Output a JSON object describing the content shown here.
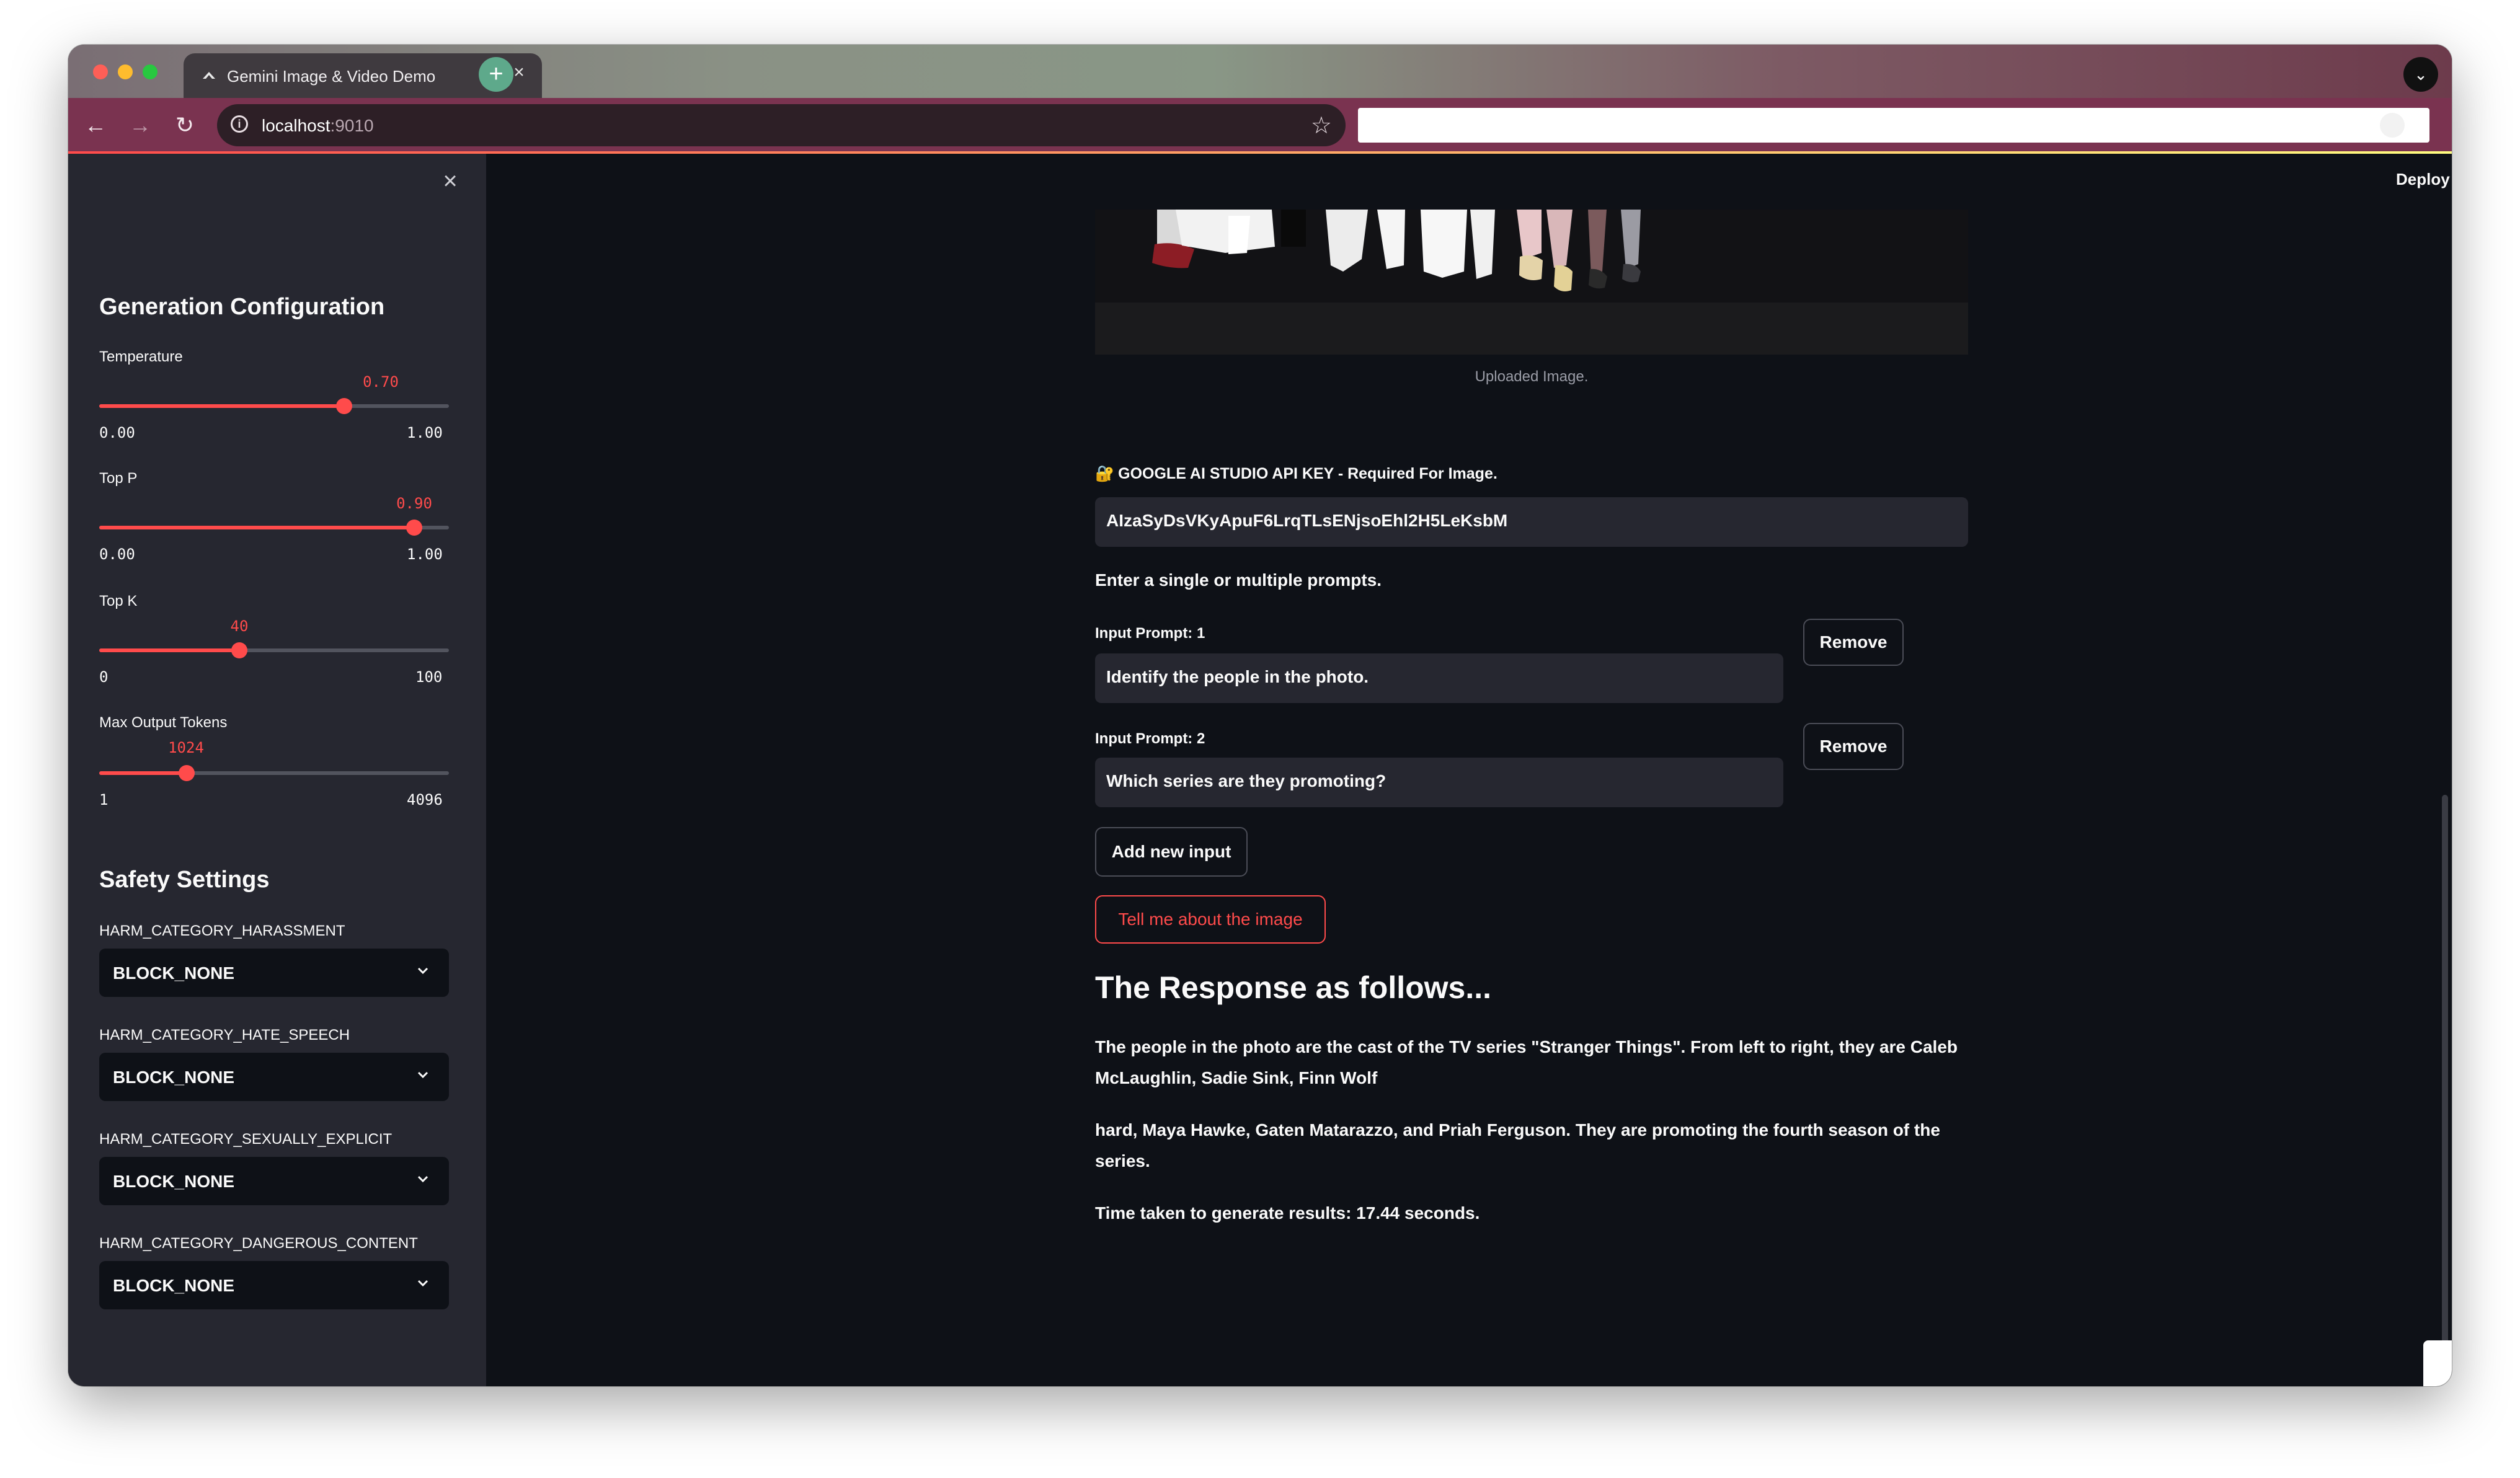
{
  "browser": {
    "tab_title": "Gemini Image & Video Demo",
    "tab_close": "×",
    "new_tab": "+",
    "url_host": "localhost",
    "url_port": ":9010",
    "back_icon": "←",
    "forward_icon": "→",
    "reload_icon": "↻",
    "star_icon": "☆",
    "tab_menu_icon": "⌄",
    "side_input_value": ""
  },
  "header": {
    "deploy_label": "Deploy",
    "menu_icon": "⋮"
  },
  "sidebar": {
    "close_icon": "×",
    "generation_title": "Generation Configuration",
    "sliders": [
      {
        "label": "Temperature",
        "value": 0.7,
        "value_text": "0.70",
        "min_text": "0.00",
        "max_text": "1.00"
      },
      {
        "label": "Top P",
        "value": 0.9,
        "value_text": "0.90",
        "min_text": "0.00",
        "max_text": "1.00"
      },
      {
        "label": "Top K",
        "value": 40,
        "value_text": "40",
        "min_text": "0",
        "max_text": "100"
      },
      {
        "label": "Max Output Tokens",
        "value": 1024,
        "value_text": "1024",
        "min_text": "1",
        "max_text": "4096"
      }
    ],
    "safety_title": "Safety Settings",
    "safety": [
      {
        "label": "HARM_CATEGORY_HARASSMENT",
        "value": "BLOCK_NONE"
      },
      {
        "label": "HARM_CATEGORY_HATE_SPEECH",
        "value": "BLOCK_NONE"
      },
      {
        "label": "HARM_CATEGORY_SEXUALLY_EXPLICIT",
        "value": "BLOCK_NONE"
      },
      {
        "label": "HARM_CATEGORY_DANGEROUS_CONTENT",
        "value": "BLOCK_NONE"
      }
    ]
  },
  "main": {
    "image_caption": "Uploaded Image.",
    "api_key_icon": "🔐",
    "api_key_label": "GOOGLE AI STUDIO API KEY - Required For Image.",
    "api_key_value": "AIzaSyDsVKyApuF6LrqTLsENjsoEhl2H5LeKsbM",
    "prompts_intro": "Enter a single or multiple prompts.",
    "prompts": [
      {
        "label": "Input Prompt: 1",
        "value": "Identify the people in the photo.",
        "remove_label": "Remove"
      },
      {
        "label": "Input Prompt: 2",
        "value": "Which series are they promoting?",
        "remove_label": "Remove"
      }
    ],
    "add_input_label": "Add new input",
    "submit_label": "Tell me about the image",
    "response_title": "The Response as follows...",
    "response_paragraphs": [
      "The people in the photo are the cast of the TV series \"Stranger Things\". From left to right, they are Caleb McLaughlin, Sadie Sink, Finn Wolf",
      "hard, Maya Hawke, Gaten Matarazzo, and Priah Ferguson. They are promoting the fourth season of the series.",
      "Time taken to generate results: 17.44 seconds."
    ]
  },
  "colors": {
    "accent": "#ff4b4b",
    "app_bg": "#0e1117",
    "sidebar_bg": "#262730",
    "toolbar": "#7a3350"
  }
}
